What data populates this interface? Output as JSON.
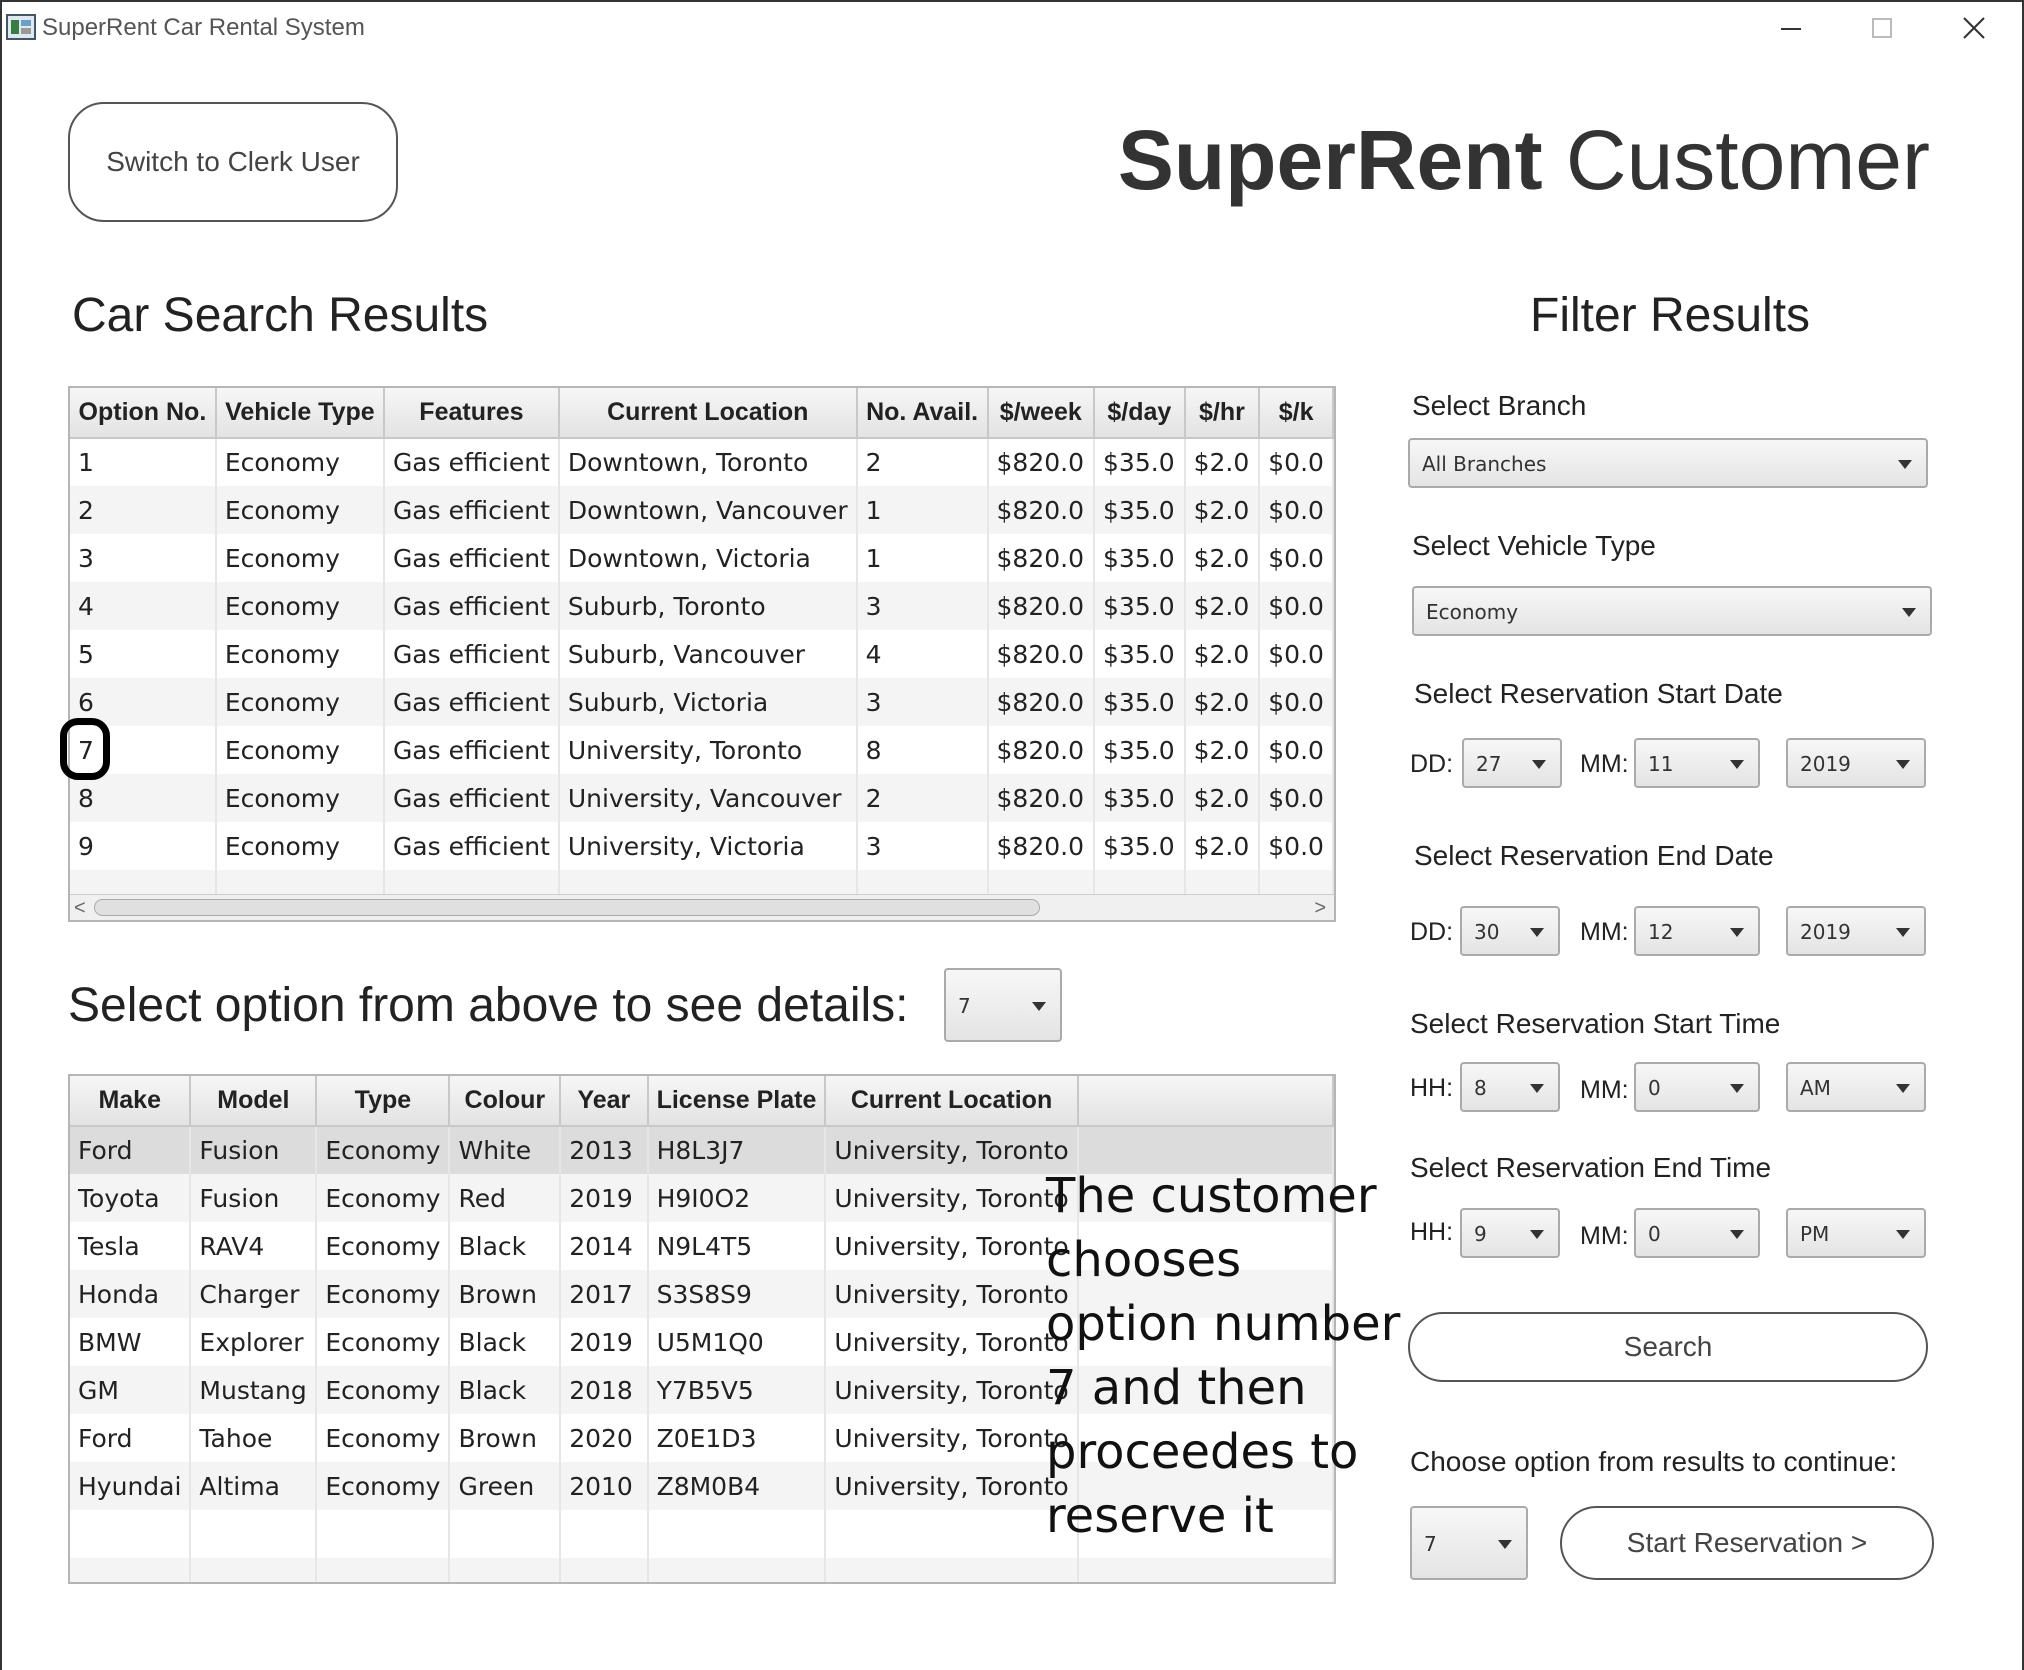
{
  "window": {
    "title": "SuperRent Car Rental System",
    "minimize_glyph": "—",
    "maximize_glyph": "☐",
    "close_glyph": "✕"
  },
  "header": {
    "switch_user_label": "Switch to Clerk User",
    "title_bold": "SuperRent",
    "title_rest": " Customer"
  },
  "results": {
    "heading": "Car Search Results",
    "columns": [
      "Option No.",
      "Vehicle Type",
      "Features",
      "Current Location",
      "No. Avail.",
      "$/week",
      "$/day",
      "$/hr",
      "$/k"
    ],
    "rows": [
      [
        "1",
        "Economy",
        "Gas efficient",
        "Downtown, Toronto",
        "2",
        "$820.0",
        "$35.0",
        "$2.0",
        "$0.0"
      ],
      [
        "2",
        "Economy",
        "Gas efficient",
        "Downtown, Vancouver",
        "1",
        "$820.0",
        "$35.0",
        "$2.0",
        "$0.0"
      ],
      [
        "3",
        "Economy",
        "Gas efficient",
        "Downtown, Victoria",
        "1",
        "$820.0",
        "$35.0",
        "$2.0",
        "$0.0"
      ],
      [
        "4",
        "Economy",
        "Gas efficient",
        "Suburb, Toronto",
        "3",
        "$820.0",
        "$35.0",
        "$2.0",
        "$0.0"
      ],
      [
        "5",
        "Economy",
        "Gas efficient",
        "Suburb, Vancouver",
        "4",
        "$820.0",
        "$35.0",
        "$2.0",
        "$0.0"
      ],
      [
        "6",
        "Economy",
        "Gas efficient",
        "Suburb, Victoria",
        "3",
        "$820.0",
        "$35.0",
        "$2.0",
        "$0.0"
      ],
      [
        "7",
        "Economy",
        "Gas efficient",
        "University, Toronto",
        "8",
        "$820.0",
        "$35.0",
        "$2.0",
        "$0.0"
      ],
      [
        "8",
        "Economy",
        "Gas efficient",
        "University, Vancouver",
        "2",
        "$820.0",
        "$35.0",
        "$2.0",
        "$0.0"
      ],
      [
        "9",
        "Economy",
        "Gas efficient",
        "University, Victoria",
        "3",
        "$820.0",
        "$35.0",
        "$2.0",
        "$0.0"
      ]
    ],
    "scroll_left_glyph": "<",
    "scroll_right_glyph": ">"
  },
  "details": {
    "prompt": "Select option from above to see details:",
    "selected_option": "7",
    "columns": [
      "Make",
      "Model",
      "Type",
      "Colour",
      "Year",
      "License Plate",
      "Current Location",
      ""
    ],
    "rows": [
      [
        "Ford",
        "Fusion",
        "Economy",
        "White",
        "2013",
        "H8L3J7",
        "University, Toronto",
        ""
      ],
      [
        "Toyota",
        "Fusion",
        "Economy",
        "Red",
        "2019",
        "H9I0O2",
        "University, Toronto",
        ""
      ],
      [
        "Tesla",
        "RAV4",
        "Economy",
        "Black",
        "2014",
        "N9L4T5",
        "University, Toronto",
        ""
      ],
      [
        "Honda",
        "Charger",
        "Economy",
        "Brown",
        "2017",
        "S3S8S9",
        "University, Toronto",
        ""
      ],
      [
        "BMW",
        "Explorer",
        "Economy",
        "Black",
        "2019",
        "U5M1Q0",
        "University, Toronto",
        ""
      ],
      [
        "GM",
        "Mustang",
        "Economy",
        "Black",
        "2018",
        "Y7B5V5",
        "University, Toronto",
        ""
      ],
      [
        "Ford",
        "Tahoe",
        "Economy",
        "Brown",
        "2020",
        "Z0E1D3",
        "University, Toronto",
        ""
      ],
      [
        "Hyundai",
        "Altima",
        "Economy",
        "Green",
        "2010",
        "Z8M0B4",
        "University, Toronto",
        ""
      ]
    ]
  },
  "annotation": "The customer chooses option number 7 and then proceedes to reserve it",
  "filter": {
    "heading": "Filter Results",
    "branch_label": "Select Branch",
    "branch_value": "All Branches",
    "vehicle_type_label": "Select Vehicle Type",
    "vehicle_type_value": "Economy",
    "start_date_label": "Select Reservation Start Date",
    "start_date": {
      "dd": "27",
      "mm": "11",
      "yyyy": "2019"
    },
    "end_date_label": "Select Reservation End Date",
    "end_date": {
      "dd": "30",
      "mm": "12",
      "yyyy": "2019"
    },
    "start_time_label": "Select Reservation Start Time",
    "start_time": {
      "hh": "8",
      "mm": "0",
      "ampm": "AM"
    },
    "end_time_label": "Select Reservation End Time",
    "end_time": {
      "hh": "9",
      "mm": "0",
      "ampm": "PM"
    },
    "dd_label": "DD:",
    "mm_label": "MM:",
    "hh_label": "HH:",
    "search_label": "Search",
    "continue_label": "Choose option from results to continue:",
    "continue_option": "7",
    "start_reservation_label": "Start Reservation >"
  },
  "colors": {
    "highlight_ring": "#000000",
    "selected_row": "#dcdcdc"
  }
}
